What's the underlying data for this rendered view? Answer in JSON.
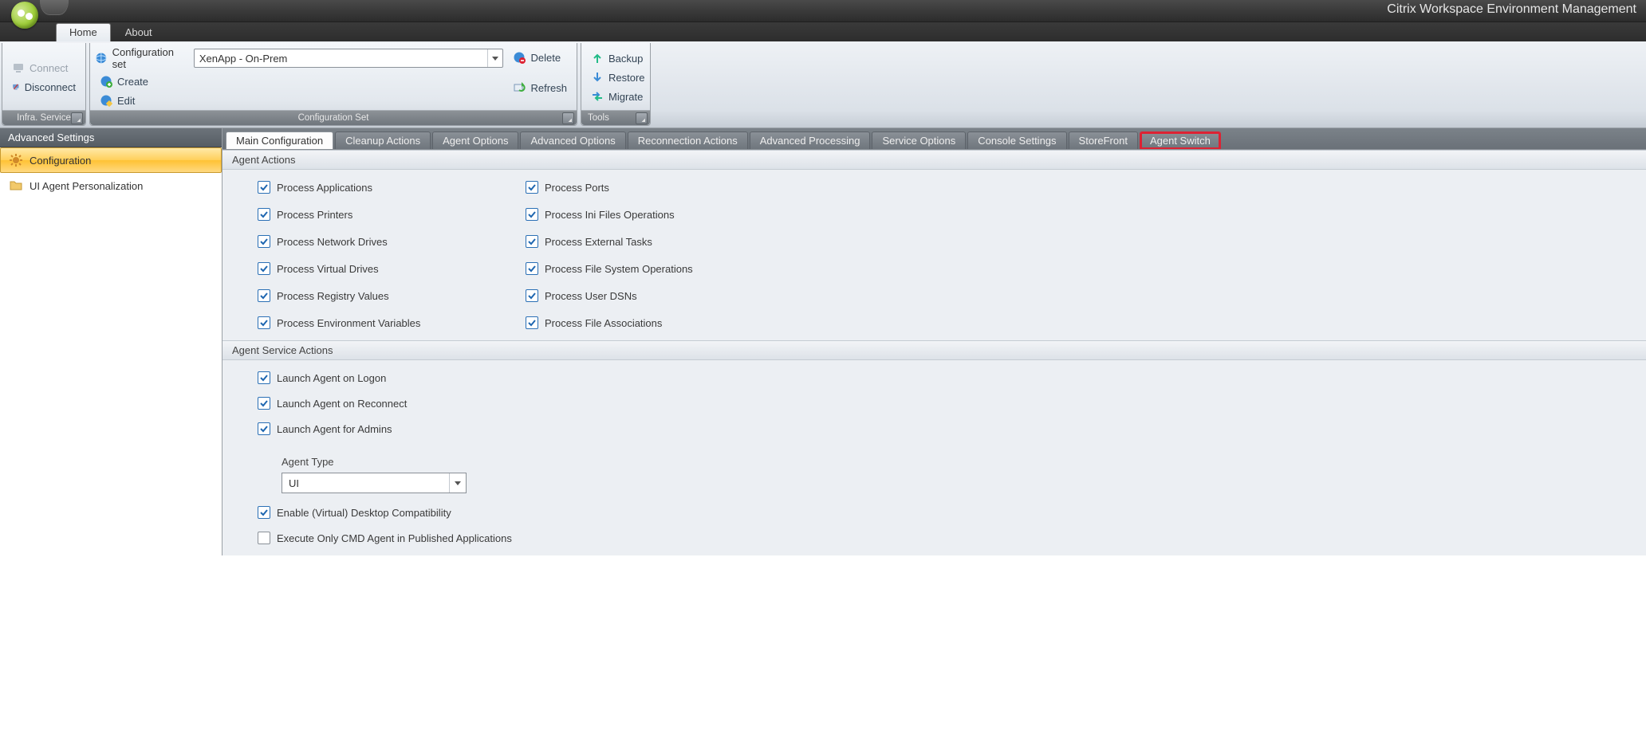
{
  "app": {
    "title": "Citrix Workspace Environment Management"
  },
  "ribbon_tabs": {
    "home": "Home",
    "about": "About"
  },
  "ribbon": {
    "infra_service_caption": "Infra. Service",
    "infra": {
      "connect": "Connect",
      "disconnect": "Disconnect"
    },
    "configset_caption": "Configuration Set",
    "configset": {
      "label": "Configuration set",
      "value": "XenApp - On-Prem",
      "create": "Create",
      "edit": "Edit",
      "delete": "Delete",
      "refresh": "Refresh"
    },
    "tools_caption": "Tools",
    "tools": {
      "backup": "Backup",
      "restore": "Restore",
      "migrate": "Migrate"
    }
  },
  "sidebar": {
    "header": "Advanced Settings",
    "items": [
      {
        "label": "Configuration"
      },
      {
        "label": "UI Agent Personalization"
      }
    ]
  },
  "main_tabs": [
    "Main Configuration",
    "Cleanup Actions",
    "Agent Options",
    "Advanced Options",
    "Reconnection Actions",
    "Advanced Processing",
    "Service Options",
    "Console Settings",
    "StoreFront",
    "Agent Switch"
  ],
  "sections": {
    "agent_actions": {
      "title": "Agent Actions",
      "left": [
        "Process Applications",
        "Process Printers",
        "Process Network Drives",
        "Process Virtual Drives",
        "Process Registry Values",
        "Process Environment Variables"
      ],
      "right": [
        "Process Ports",
        "Process Ini Files Operations",
        "Process External Tasks",
        "Process File System Operations",
        "Process User DSNs",
        "Process File Associations"
      ]
    },
    "agent_service_actions": {
      "title": "Agent Service Actions",
      "items": {
        "launch_logon": "Launch Agent on Logon",
        "launch_reconnect": "Launch Agent on Reconnect",
        "launch_admins": "Launch Agent for Admins",
        "agent_type_label": "Agent Type",
        "agent_type_value": "UI",
        "enable_vdesktop": "Enable (Virtual) Desktop Compatibility",
        "exec_cmd_only": "Execute Only CMD Agent in Published Applications"
      }
    }
  }
}
